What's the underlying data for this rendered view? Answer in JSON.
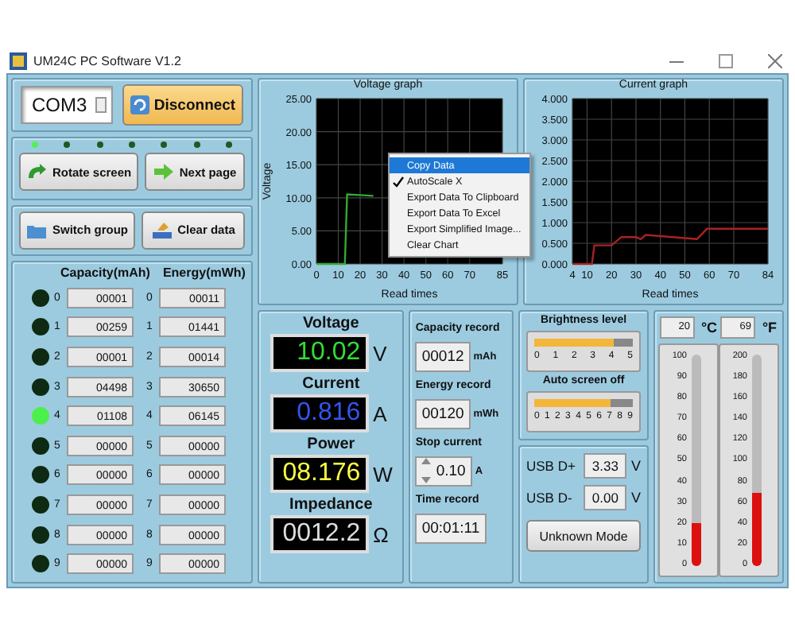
{
  "window": {
    "title": "UM24C PC Software V1.2"
  },
  "connection": {
    "port": "COM3",
    "button": "Disconnect"
  },
  "leds": [
    {
      "on": true
    },
    {
      "on": false
    },
    {
      "on": false
    },
    {
      "on": false
    },
    {
      "on": false
    },
    {
      "on": false
    },
    {
      "on": false
    }
  ],
  "nav_buttons": [
    {
      "label": "Rotate screen",
      "kind": "rotate"
    },
    {
      "label": "Next page",
      "kind": "next"
    }
  ],
  "group_buttons": [
    {
      "label": "Switch group",
      "kind": "switch"
    },
    {
      "label": "Clear data",
      "kind": "clear"
    }
  ],
  "groups": {
    "columns": [
      "Capacity(mAh)",
      "Energy(mWh)"
    ],
    "rows": [
      {
        "capacity_index": "0",
        "capacity": "00001",
        "energy_index": "0",
        "energy": "00011",
        "selected": false
      },
      {
        "capacity_index": "1",
        "capacity": "00259",
        "energy_index": "1",
        "energy": "01441",
        "selected": false
      },
      {
        "capacity_index": "2",
        "capacity": "00001",
        "energy_index": "2",
        "energy": "00014",
        "selected": false
      },
      {
        "capacity_index": "3",
        "capacity": "04498",
        "energy_index": "3",
        "energy": "30650",
        "selected": false
      },
      {
        "capacity_index": "4",
        "capacity": "01108",
        "energy_index": "4",
        "energy": "06145",
        "selected": true
      },
      {
        "capacity_index": "5",
        "capacity": "00000",
        "energy_index": "5",
        "energy": "00000",
        "selected": false
      },
      {
        "capacity_index": "6",
        "capacity": "00000",
        "energy_index": "6",
        "energy": "00000",
        "selected": false
      },
      {
        "capacity_index": "7",
        "capacity": "00000",
        "energy_index": "7",
        "energy": "00000",
        "selected": false
      },
      {
        "capacity_index": "8",
        "capacity": "00000",
        "energy_index": "8",
        "energy": "00000",
        "selected": false
      },
      {
        "capacity_index": "9",
        "capacity": "00000",
        "energy_index": "9",
        "energy": "00000",
        "selected": false
      }
    ]
  },
  "charts": [
    {
      "chart_data": {
        "type": "line",
        "title": "Voltage graph",
        "xlabel": "Read times",
        "ylabel": "Voltage",
        "grid": true,
        "x": [
          0,
          13,
          14,
          20,
          26
        ],
        "series": [
          {
            "color": "#33aa33",
            "values": [
              0,
              0,
              10.5,
              10.4,
              10.3
            ]
          }
        ],
        "xlim": [
          0,
          85
        ],
        "ylim": [
          0,
          25
        ],
        "xticks": [
          0,
          10,
          20,
          30,
          40,
          50,
          60,
          70,
          85
        ],
        "yticks": [
          {
            "value": 0,
            "label": "0.00"
          },
          {
            "value": 5,
            "label": "5.00"
          },
          {
            "value": 10,
            "label": "10.00"
          },
          {
            "value": 15,
            "label": "15.00"
          },
          {
            "value": 20,
            "label": "20.00"
          },
          {
            "value": 25,
            "label": "25.00"
          }
        ]
      }
    },
    {
      "chart_data": {
        "type": "line",
        "title": "Current graph",
        "xlabel": "Read times",
        "grid": true,
        "x": [
          4,
          12,
          13,
          20,
          24,
          30,
          32,
          34,
          55,
          59,
          84
        ],
        "series": [
          {
            "color": "#aa2222",
            "values": [
              0,
              0,
              0.45,
              0.45,
              0.65,
              0.65,
              0.6,
              0.7,
              0.6,
              0.85,
              0.85
            ]
          }
        ],
        "xlim": [
          4,
          84
        ],
        "ylim": [
          0,
          4
        ],
        "xticks": [
          4,
          10,
          20,
          30,
          40,
          50,
          60,
          70,
          84
        ],
        "yticks": [
          {
            "value": 0,
            "label": "0.000"
          },
          {
            "value": 0.5,
            "label": "0.500"
          },
          {
            "value": 1,
            "label": "1.000"
          },
          {
            "value": 1.5,
            "label": "1.500"
          },
          {
            "value": 2,
            "label": "2.000"
          },
          {
            "value": 2.5,
            "label": "2.500"
          },
          {
            "value": 3,
            "label": "3.000"
          },
          {
            "value": 3.5,
            "label": "3.500"
          },
          {
            "value": 4,
            "label": "4.000"
          }
        ]
      }
    }
  ],
  "context_menu": [
    {
      "label": "Copy Data",
      "selected": true,
      "checked": false
    },
    {
      "label": "AutoScale X",
      "selected": false,
      "checked": true
    },
    {
      "label": "Export Data To Clipboard",
      "selected": false,
      "checked": false
    },
    {
      "label": "Export Data To Excel",
      "selected": false,
      "checked": false
    },
    {
      "label": "Export Simplified Image...",
      "selected": false,
      "checked": false
    },
    {
      "label": "Clear Chart",
      "selected": false,
      "checked": false
    }
  ],
  "readings": [
    {
      "label": "Voltage",
      "value": "10.02",
      "unit": "V",
      "color": "#33dd33"
    },
    {
      "label": "Current",
      "value": "0.816",
      "unit": "A",
      "color": "#3355ee"
    },
    {
      "label": "Power",
      "value": "08.176",
      "unit": "W",
      "color": "#ffff44"
    },
    {
      "label": "Impedance",
      "value": "0012.2",
      "unit": "Ω",
      "color": "#dddddd"
    }
  ],
  "records": [
    {
      "kind": "display",
      "label": "Capacity record",
      "value": "00012",
      "unit": "mAh"
    },
    {
      "kind": "display",
      "label": "Energy record",
      "value": "00120",
      "unit": "mWh"
    },
    {
      "kind": "spinner",
      "label": "Stop current",
      "value": "0.10",
      "unit": "A"
    },
    {
      "kind": "display",
      "label": "Time record",
      "value": "00:01:11"
    }
  ],
  "sliders": [
    {
      "label": "Brightness level",
      "level": 0.8,
      "ticks": [
        "0",
        "1",
        "2",
        "3",
        "4",
        "5"
      ]
    },
    {
      "label": "Auto screen off",
      "level": 0.778,
      "ticks": [
        "0",
        "1",
        "2",
        "3",
        "4",
        "5",
        "6",
        "7",
        "8",
        "9"
      ]
    }
  ],
  "usb": [
    {
      "label": "USB D+",
      "value": "3.33",
      "unit": "V"
    },
    {
      "label": "USB D-",
      "value": "0.00",
      "unit": "V"
    }
  ],
  "mode_button": "Unknown Mode",
  "thermometers": [
    {
      "value": "20",
      "unit": "°C",
      "level": 0.2,
      "scale": [
        "100",
        "90",
        "80",
        "70",
        "60",
        "50",
        "40",
        "30",
        "20",
        "10",
        "0"
      ]
    },
    {
      "value": "69",
      "unit": "°F",
      "level": 0.345,
      "scale": [
        "200",
        "180",
        "160",
        "140",
        "120",
        "100",
        "80",
        "60",
        "40",
        "20",
        "0"
      ]
    }
  ]
}
